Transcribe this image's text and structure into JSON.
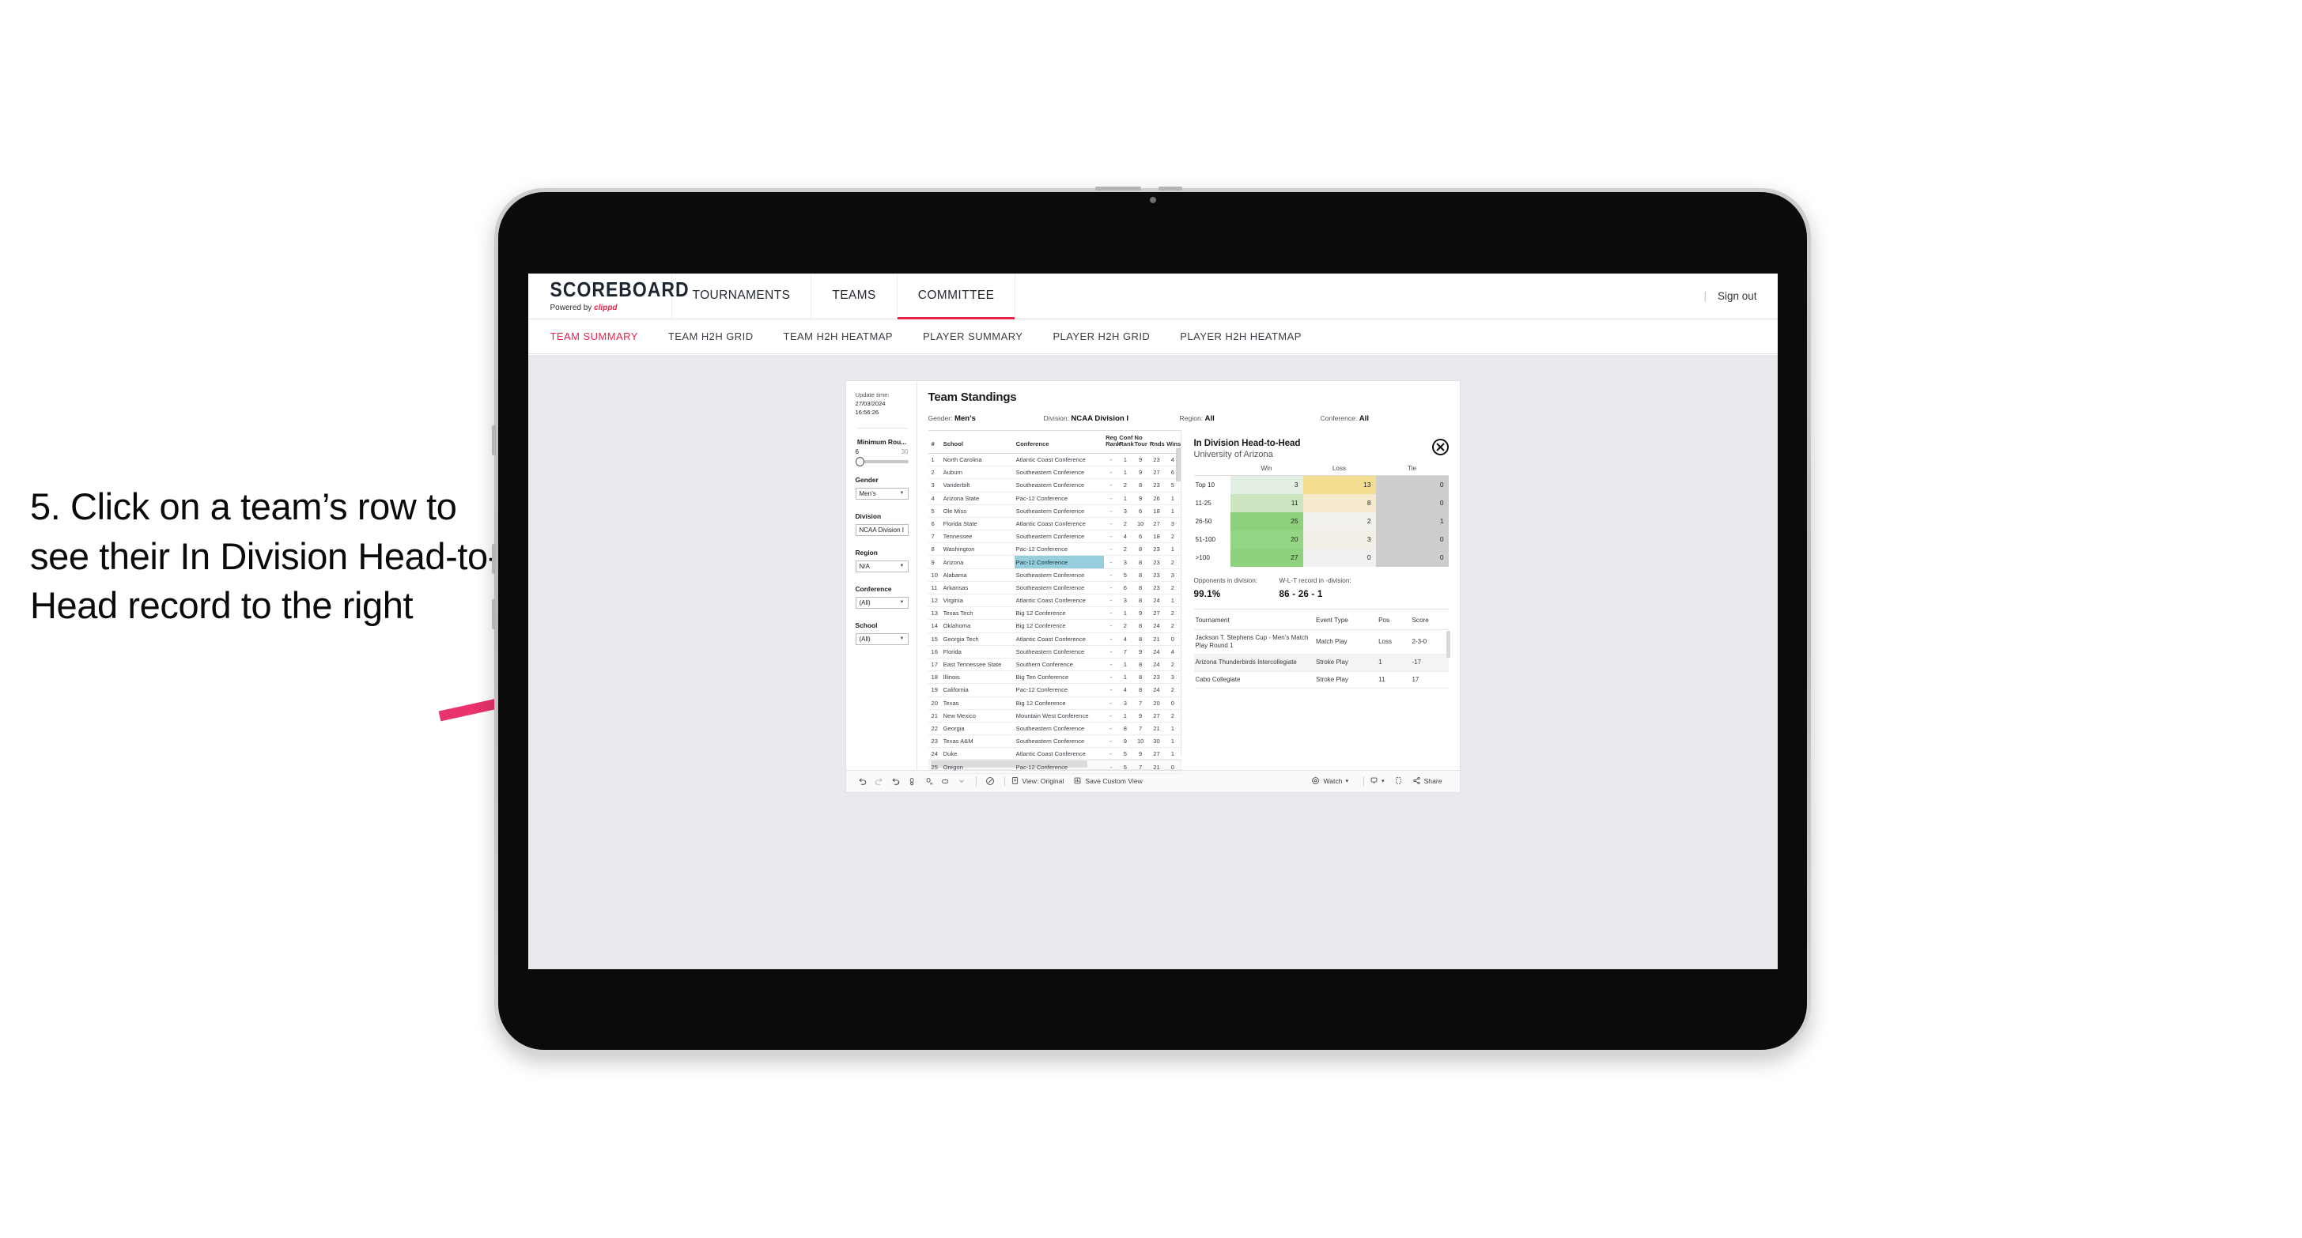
{
  "annotation": {
    "text": "5. Click on a team’s row to see their In Division Head-to-Head record to the right",
    "arrow_color": "#e8336b"
  },
  "app": {
    "logo_main": "SCOREBOARD",
    "logo_powered": "Powered by",
    "logo_brand": "clippd",
    "nav_tabs": [
      {
        "label": "TOURNAMENTS",
        "active": false
      },
      {
        "label": "TEAMS",
        "active": false
      },
      {
        "label": "COMMITTEE",
        "active": true
      }
    ],
    "sign_out": "Sign out",
    "divider": "|",
    "sub_tabs": [
      {
        "label": "TEAM SUMMARY",
        "active": true
      },
      {
        "label": "TEAM H2H GRID",
        "active": false
      },
      {
        "label": "TEAM H2H HEATMAP",
        "active": false
      },
      {
        "label": "PLAYER SUMMARY",
        "active": false
      },
      {
        "label": "PLAYER H2H GRID",
        "active": false
      },
      {
        "label": "PLAYER H2H HEATMAP",
        "active": false
      }
    ]
  },
  "filters": {
    "update_label": "Update time:",
    "update_time": "27/03/2024 16:56:26",
    "slider": {
      "title": "Minimum Rou...",
      "min": "6",
      "max": "30"
    },
    "groups": [
      {
        "title": "Gender",
        "value": "Men’s"
      },
      {
        "title": "Division",
        "value": "NCAA Division I"
      },
      {
        "title": "Region",
        "value": "N/A"
      },
      {
        "title": "Conference",
        "value": "(All)"
      },
      {
        "title": "School",
        "value": "(All)"
      }
    ]
  },
  "standings": {
    "title": "Team Standings",
    "filter_chips": [
      {
        "label": "Gender:",
        "value": "Men’s"
      },
      {
        "label": "Division:",
        "value": "NCAA Division I"
      },
      {
        "label": "Region:",
        "value": "All"
      },
      {
        "label": "Conference:",
        "value": "All"
      }
    ],
    "columns": [
      "#",
      "School",
      "Conference",
      "Reg Rank",
      "Conf Rank",
      "No Tour",
      "Rnds",
      "Wins"
    ],
    "rows": [
      {
        "num": "1",
        "school": "North Carolina",
        "conference": "Atlantic Coast Conference",
        "reg_rank": "-",
        "conf_rank": "1",
        "no_tour": "9",
        "rnds": "23",
        "wins": "4",
        "selected": false
      },
      {
        "num": "2",
        "school": "Auburn",
        "conference": "Southeastern Conference",
        "reg_rank": "-",
        "conf_rank": "1",
        "no_tour": "9",
        "rnds": "27",
        "wins": "6",
        "selected": false
      },
      {
        "num": "3",
        "school": "Vanderbilt",
        "conference": "Southeastern Conference",
        "reg_rank": "-",
        "conf_rank": "2",
        "no_tour": "8",
        "rnds": "23",
        "wins": "5",
        "selected": false
      },
      {
        "num": "4",
        "school": "Arizona State",
        "conference": "Pac-12 Conference",
        "reg_rank": "-",
        "conf_rank": "1",
        "no_tour": "9",
        "rnds": "26",
        "wins": "1",
        "selected": false
      },
      {
        "num": "5",
        "school": "Ole Miss",
        "conference": "Southeastern Conference",
        "reg_rank": "-",
        "conf_rank": "3",
        "no_tour": "6",
        "rnds": "18",
        "wins": "1",
        "selected": false
      },
      {
        "num": "6",
        "school": "Florida State",
        "conference": "Atlantic Coast Conference",
        "reg_rank": "-",
        "conf_rank": "2",
        "no_tour": "10",
        "rnds": "27",
        "wins": "3",
        "selected": false
      },
      {
        "num": "7",
        "school": "Tennessee",
        "conference": "Southeastern Conference",
        "reg_rank": "-",
        "conf_rank": "4",
        "no_tour": "6",
        "rnds": "18",
        "wins": "2",
        "selected": false
      },
      {
        "num": "8",
        "school": "Washington",
        "conference": "Pac-12 Conference",
        "reg_rank": "-",
        "conf_rank": "2",
        "no_tour": "8",
        "rnds": "23",
        "wins": "1",
        "selected": false
      },
      {
        "num": "9",
        "school": "Arizona",
        "conference": "Pac-12 Conference",
        "reg_rank": "-",
        "conf_rank": "3",
        "no_tour": "8",
        "rnds": "23",
        "wins": "2",
        "selected": true
      },
      {
        "num": "10",
        "school": "Alabama",
        "conference": "Southeastern Conference",
        "reg_rank": "-",
        "conf_rank": "5",
        "no_tour": "8",
        "rnds": "23",
        "wins": "3",
        "selected": false
      },
      {
        "num": "11",
        "school": "Arkansas",
        "conference": "Southeastern Conference",
        "reg_rank": "-",
        "conf_rank": "6",
        "no_tour": "8",
        "rnds": "23",
        "wins": "2",
        "selected": false
      },
      {
        "num": "12",
        "school": "Virginia",
        "conference": "Atlantic Coast Conference",
        "reg_rank": "-",
        "conf_rank": "3",
        "no_tour": "8",
        "rnds": "24",
        "wins": "1",
        "selected": false
      },
      {
        "num": "13",
        "school": "Texas Tech",
        "conference": "Big 12 Conference",
        "reg_rank": "-",
        "conf_rank": "1",
        "no_tour": "9",
        "rnds": "27",
        "wins": "2",
        "selected": false
      },
      {
        "num": "14",
        "school": "Oklahoma",
        "conference": "Big 12 Conference",
        "reg_rank": "-",
        "conf_rank": "2",
        "no_tour": "8",
        "rnds": "24",
        "wins": "2",
        "selected": false
      },
      {
        "num": "15",
        "school": "Georgia Tech",
        "conference": "Atlantic Coast Conference",
        "reg_rank": "-",
        "conf_rank": "4",
        "no_tour": "8",
        "rnds": "21",
        "wins": "0",
        "selected": false
      },
      {
        "num": "16",
        "school": "Florida",
        "conference": "Southeastern Conference",
        "reg_rank": "-",
        "conf_rank": "7",
        "no_tour": "9",
        "rnds": "24",
        "wins": "4",
        "selected": false
      },
      {
        "num": "17",
        "school": "East Tennessee State",
        "conference": "Southern Conference",
        "reg_rank": "-",
        "conf_rank": "1",
        "no_tour": "8",
        "rnds": "24",
        "wins": "2",
        "selected": false
      },
      {
        "num": "18",
        "school": "Illinois",
        "conference": "Big Ten Conference",
        "reg_rank": "-",
        "conf_rank": "1",
        "no_tour": "8",
        "rnds": "23",
        "wins": "3",
        "selected": false
      },
      {
        "num": "19",
        "school": "California",
        "conference": "Pac-12 Conference",
        "reg_rank": "-",
        "conf_rank": "4",
        "no_tour": "8",
        "rnds": "24",
        "wins": "2",
        "selected": false
      },
      {
        "num": "20",
        "school": "Texas",
        "conference": "Big 12 Conference",
        "reg_rank": "-",
        "conf_rank": "3",
        "no_tour": "7",
        "rnds": "20",
        "wins": "0",
        "selected": false
      },
      {
        "num": "21",
        "school": "New Mexico",
        "conference": "Mountain West Conference",
        "reg_rank": "-",
        "conf_rank": "1",
        "no_tour": "9",
        "rnds": "27",
        "wins": "2",
        "selected": false
      },
      {
        "num": "22",
        "school": "Georgia",
        "conference": "Southeastern Conference",
        "reg_rank": "-",
        "conf_rank": "8",
        "no_tour": "7",
        "rnds": "21",
        "wins": "1",
        "selected": false
      },
      {
        "num": "23",
        "school": "Texas A&M",
        "conference": "Southeastern Conference",
        "reg_rank": "-",
        "conf_rank": "9",
        "no_tour": "10",
        "rnds": "30",
        "wins": "1",
        "selected": false
      },
      {
        "num": "24",
        "school": "Duke",
        "conference": "Atlantic Coast Conference",
        "reg_rank": "-",
        "conf_rank": "5",
        "no_tour": "9",
        "rnds": "27",
        "wins": "1",
        "selected": false
      },
      {
        "num": "25",
        "school": "Oregon",
        "conference": "Pac-12 Conference",
        "reg_rank": "-",
        "conf_rank": "5",
        "no_tour": "7",
        "rnds": "21",
        "wins": "0",
        "selected": false
      }
    ]
  },
  "detail": {
    "title": "In Division Head-to-Head",
    "subtitle": "University of Arizona",
    "close_icon": "close-icon",
    "chart_data": {
      "type": "heatmap",
      "title": "In Division Head-to-Head",
      "subtitle": "University of Arizona",
      "columns": [
        "Win",
        "Loss",
        "Tie"
      ],
      "rows": [
        "Top 10",
        "11-25",
        "26-50",
        "51-100",
        ">100"
      ],
      "values": [
        [
          3,
          13,
          0
        ],
        [
          11,
          8,
          0
        ],
        [
          25,
          2,
          1
        ],
        [
          20,
          3,
          0
        ],
        [
          27,
          0,
          0
        ]
      ],
      "cell_colors": [
        [
          "#e4efe3",
          "#f2dd91",
          "#cdcdcd"
        ],
        [
          "#cae5bf",
          "#f5eacd",
          "#cdcdcd"
        ],
        [
          "#8ed07c",
          "#f2f0ec",
          "#cdcdcd"
        ],
        [
          "#95d586",
          "#f3efe7",
          "#cdcdcd"
        ],
        [
          "#8fd27e",
          "#f1f1f0",
          "#cdcdcd"
        ]
      ],
      "legend_position": "none",
      "grid": false
    },
    "summary": [
      {
        "label": "Opponents in division:",
        "value": "99.1%"
      },
      {
        "label": "W-L-T record in -division:",
        "value": "86 - 26 - 1"
      }
    ],
    "tournament_columns": [
      "Tournament",
      "Event Type",
      "Pos",
      "Score"
    ],
    "tournaments": [
      {
        "name": "Jackson T. Stephens Cup - Men’s Match Play Round 1",
        "event_type": "Match Play",
        "pos": "Loss",
        "score": "2-3-0"
      },
      {
        "name": "Arizona Thunderbirds Intercollegiate",
        "event_type": "Stroke Play",
        "pos": "1",
        "score": "-17"
      },
      {
        "name": "Cabo Collegiate",
        "event_type": "Stroke Play",
        "pos": "11",
        "score": "17"
      }
    ]
  },
  "toolbar": {
    "icons": [
      "undo-icon",
      "redo-icon",
      "revert-icon",
      "refresh-icon",
      "pause-icon",
      "presentation-icon",
      "chevron-down-icon"
    ],
    "alert_icon": "alert-icon",
    "view_icon": "view-icon",
    "view_label": "View: Original",
    "save_icon": "save-view-icon",
    "save_label": "Save Custom View",
    "watch_icon": "watch-icon",
    "watch_label": "Watch",
    "watch_caret": "▾",
    "comment_icon": "comment-icon",
    "comment_caret": "▾",
    "fullscreen_icon": "fullscreen-icon",
    "share_icon": "share-icon",
    "share_label": "Share"
  }
}
